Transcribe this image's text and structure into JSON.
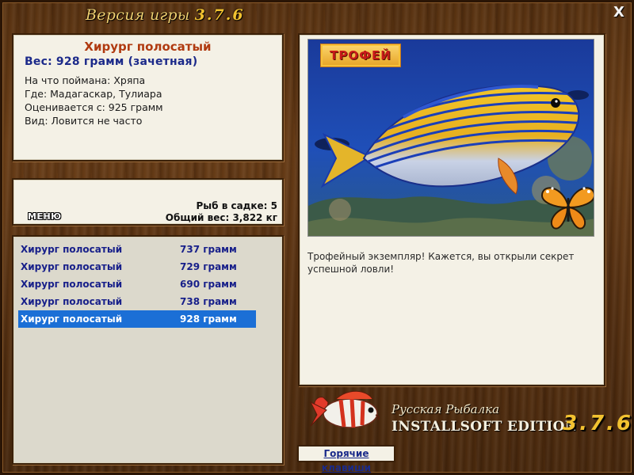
{
  "window": {
    "title": "Версия игры",
    "version": "3.7.6",
    "close_label": "X"
  },
  "fish_info": {
    "name": "Хирург полосатый",
    "weight": "Вес: 928 грамм (зачетная)",
    "lines": [
      "На что поймана: Хряпа",
      "Где: Мадагаскар, Тулиара",
      "Оценивается с: 925 грамм",
      "Вид: Ловится не часто"
    ]
  },
  "cage": {
    "menu_label": "МЕНЮ",
    "fish_count": "Рыб в садке: 5",
    "total_weight": "Общий вес: 3,822 кг"
  },
  "catch_list": [
    {
      "name": "Хирург полосатый",
      "weight": "737 грамм",
      "selected": false
    },
    {
      "name": "Хирург полосатый",
      "weight": "729 грамм",
      "selected": false
    },
    {
      "name": "Хирург полосатый",
      "weight": "690 грамм",
      "selected": false
    },
    {
      "name": "Хирург полосатый",
      "weight": "738 грамм",
      "selected": false
    },
    {
      "name": "Хирург полосатый",
      "weight": "928 грамм",
      "selected": true
    }
  ],
  "trophy": {
    "badge": "ТРОФЕЙ",
    "message": "Трофейный экземпляр! Кажется, вы открыли секрет успешной ловли!"
  },
  "logo": {
    "line1": "Русская Рыбалка",
    "line2": "INSTALLSOFT EDITION",
    "version": "3.7.6"
  },
  "footer": {
    "hotkeys_label": "Горячие клавиши"
  },
  "colors": {
    "wood": "#5a3412",
    "panel_bg": "#f4f1e6",
    "fish_name": "#b03a10",
    "link_blue": "#18208a",
    "selection": "#1b6fd6",
    "version_gold": "#f2c230"
  },
  "icons": {
    "close": "close-icon",
    "logo_fish": "striped-fish-logo-icon",
    "butterfly": "butterfly-icon"
  }
}
